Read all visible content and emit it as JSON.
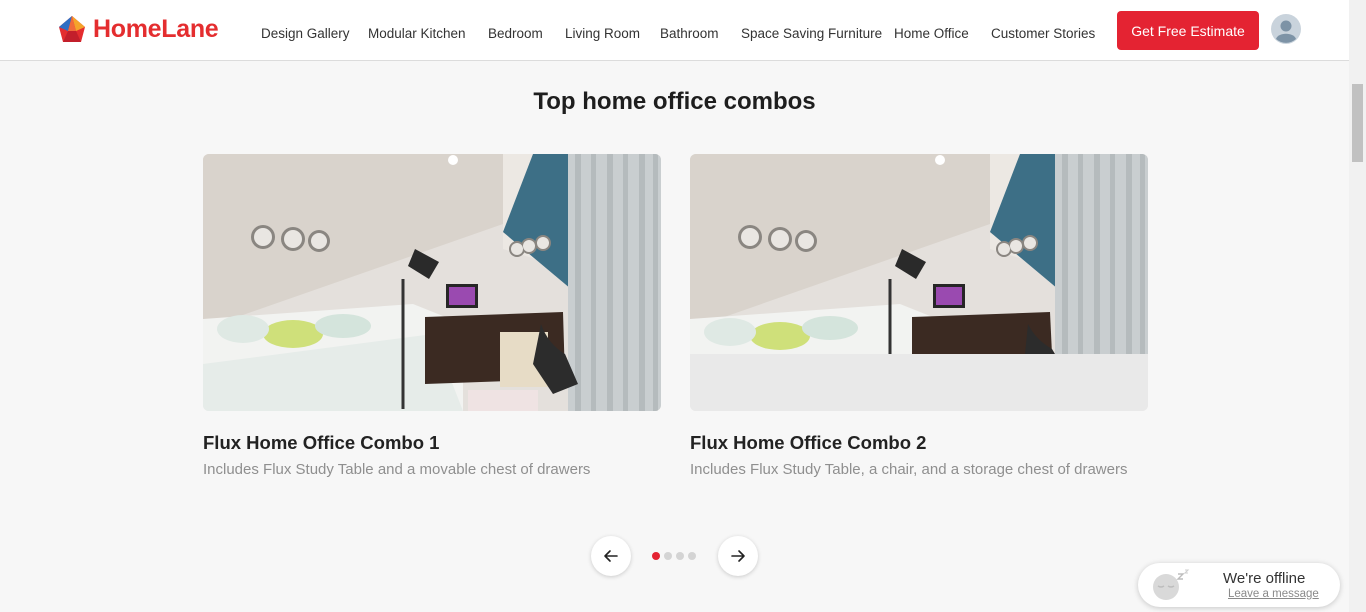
{
  "header": {
    "brand": "HomeLane",
    "nav": [
      "Design Gallery",
      "Modular Kitchen",
      "Bedroom",
      "Living Room",
      "Bathroom",
      "Space Saving Furniture",
      "Home Office",
      "Customer Stories"
    ],
    "cta_label": "Get Free Estimate",
    "accent_color": "#e42332"
  },
  "main": {
    "section_title": "Top home office combos",
    "cards": [
      {
        "title": "Flux Home Office Combo 1",
        "description": "Includes Flux Study Table and a movable chest of drawers"
      },
      {
        "title": "Flux Home Office Combo 2",
        "description": "Includes Flux Study Table, a chair, and a storage chest of drawers"
      }
    ],
    "carousel": {
      "page_count": 4,
      "active_page": 1
    }
  },
  "chat": {
    "title": "We're offline",
    "subtitle": "Leave a message"
  },
  "icons": {
    "logo": "homelane-logo-icon",
    "avatar": "user-avatar-icon",
    "prev": "arrow-left-icon",
    "next": "arrow-right-icon",
    "chat": "sleeping-chat-icon"
  }
}
